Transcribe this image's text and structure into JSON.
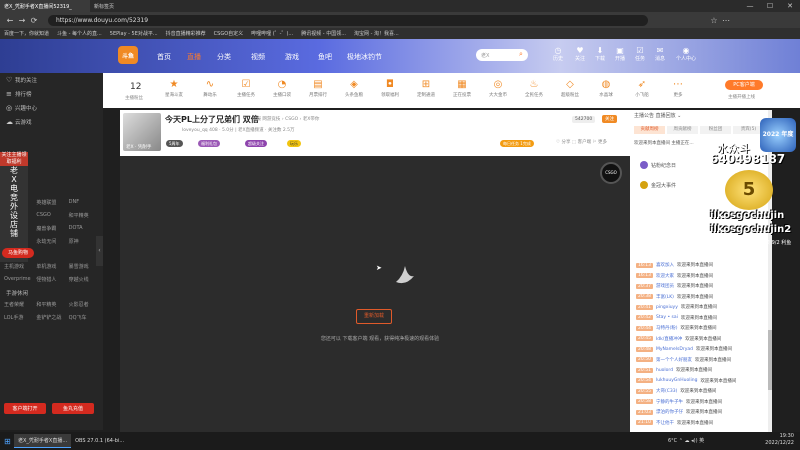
{
  "browser": {
    "tabs": [
      {
        "label": "老X_凭耐手者X直播间52319_"
      },
      {
        "label": "新标签页"
      }
    ],
    "url": "https://www.douyu.com/52319",
    "bookmarks": [
      "百度一下，你就知道",
      "斗鱼 - 每个人的直...",
      "5EPlay - 5E对战平...",
      "抖音直播精彩推荐",
      "CSGO自定义",
      "哔哩哔哩 (゜-゜)...",
      "腾讯视频 - 中国领...",
      "淘宝网 - 淘！我喜..."
    ]
  },
  "site": {
    "logo": "斗鱼",
    "nav": [
      {
        "label": "首页",
        "active": false
      },
      {
        "label": "直播",
        "active": true
      },
      {
        "label": "分类",
        "active": false
      },
      {
        "label": "视频",
        "active": false
      },
      {
        "label": "游戏",
        "active": false
      },
      {
        "label": "鱼吧",
        "active": false
      },
      {
        "label": "极地冰钓节",
        "active": false
      }
    ],
    "search_placeholder": "老X",
    "right_icons": [
      {
        "icon": "history-icon",
        "label": "历史"
      },
      {
        "icon": "follow-icon",
        "label": "关注"
      },
      {
        "icon": "download-icon",
        "label": "下载"
      },
      {
        "icon": "live-icon",
        "label": "开播"
      },
      {
        "icon": "task-icon",
        "label": "任务"
      },
      {
        "icon": "friend-icon",
        "label": "消息"
      },
      {
        "icon": "member-icon",
        "label": "个人中心"
      }
    ]
  },
  "sidebar": {
    "top_items": [
      {
        "label": "我的关注"
      },
      {
        "label": "排行榜"
      },
      {
        "label": "兴趣中心"
      },
      {
        "label": "云游戏"
      }
    ],
    "hot_games": [
      "热门游戏",
      "英雄联盟",
      "DNF",
      "绝地求生",
      "CSGO",
      "和平精英",
      "王者荣耀",
      "魔兽争霸",
      "DOTA",
      "APEX",
      "永劫无间",
      "原神"
    ],
    "section_single": "单机热游",
    "single_games": [
      "主机游戏",
      "单机游戏",
      "暴雪游戏",
      "Overprime",
      "怪物猎人",
      "穿越火线"
    ],
    "section_mobile": "手游休闲",
    "mobile_games": [
      "王者荣耀",
      "和平精英",
      "火影忍者",
      "LOL手游",
      "金铲铲之战",
      "QQ飞车"
    ],
    "btn_open_live": "客户端打开",
    "btn_recharge": "鱼丸充值"
  },
  "left_overlay": {
    "badge": "关注主播领取福利",
    "chars": [
      "老",
      "X",
      "电",
      "竞",
      "外",
      "设",
      "店",
      "铺"
    ],
    "button": "马鱼购物"
  },
  "gift_bar": {
    "count": "12",
    "count_label": "主播粉丝",
    "items": [
      "星海斗友",
      "舞动乐",
      "主播任务",
      "主播口袋",
      "月票排行",
      "头条鱼粮",
      "领取福利",
      "定制通道",
      "正在投票",
      "大大金币",
      "全民任务",
      "超级粉丝",
      "水晶球",
      "小飞船",
      "更多"
    ],
    "pc_button": "PC客户端",
    "pc_link": "主播开播上线"
  },
  "room": {
    "avatar_name": "老X · 凭耐手",
    "title": "今天PL上分了兄弟们 双倍",
    "meta": "举报  网游竞技 › CSGO › 老X带你",
    "streamer": "loveyou_qq  408  · 5.0分 | 老X直播频道  · 关注数 2.5万",
    "tags": [
      "5周年",
      "福利礼包",
      "超级关注",
      "玩乐"
    ],
    "task_tag": "每日任务 1完成",
    "right_actions": "♡ 分享   ⬚ 客户端   ⚐ 更多",
    "replay_button": "重新加载",
    "tip": "您还可以 下载客户端 观看，获得纯净极速的观看体验",
    "corner_logo": "CSGO"
  },
  "chat": {
    "tabs": "主播公告    直播回放 ⌄",
    "subtabs": [
      {
        "label": "贡献周榜",
        "active": true
      },
      {
        "label": "周贡献榜",
        "active": false
      },
      {
        "label": "粉丝团",
        "active": false
      },
      {
        "label": "贵宾(5)",
        "active": false
      }
    ],
    "notice": "欢迎来到本直播间  主播正在...",
    "ranks": [
      {
        "name": "钻粉纪念日"
      },
      {
        "name": "金冠大事件"
      }
    ],
    "messages": [
      {
        "time": "16:13",
        "name": "喜欢加入",
        "text": "欢迎来到本直播间"
      },
      {
        "time": "16:13",
        "name": "欢迎大家",
        "text": "欢迎来到本直播间"
      },
      {
        "time": "20:37",
        "name": "游戏团员",
        "text": "欢迎来到本直播间"
      },
      {
        "time": "20:38",
        "name": "丰富(LK)",
        "text": "欢迎来到本直播间"
      },
      {
        "time": "20:41",
        "name": "pingxiuyy",
        "text": "欢迎来到本直播间"
      },
      {
        "time": "20:42",
        "name": "Stay • sai",
        "text": "欢迎来到本直播间"
      },
      {
        "time": "20:44",
        "name": "马特丹(粉)",
        "text": "欢迎来到本直播间"
      },
      {
        "time": "20:45",
        "name": "Idk/直播冲冲",
        "text": "欢迎来到本直播间"
      },
      {
        "time": "20:48",
        "name": "MyNamelsDryad",
        "text": "欢迎来到本直播间"
      },
      {
        "time": "20:50",
        "name": "第一个个人好朋友",
        "text": "欢迎来到本直播间"
      },
      {
        "time": "20:51",
        "name": "huolord",
        "text": "欢迎来到本直播间"
      },
      {
        "time": "20:54",
        "name": "lukhuuyGnHuoling",
        "text": "欢迎来到本直播间"
      },
      {
        "time": "20:55",
        "name": "大哥(C33)",
        "text": "欢迎来到本直播间"
      },
      {
        "time": "20:58",
        "name": "宁静的牛子牛",
        "text": "欢迎来到本直播间"
      },
      {
        "time": "21:03",
        "name": "漂泊的你子仔",
        "text": "欢迎来到本直播间"
      },
      {
        "time": "21:10",
        "name": "不让他干",
        "text": "欢迎来到本直播间"
      }
    ]
  },
  "right_overlay": {
    "line1": "水众斗",
    "line2": "640498187",
    "gold": "5",
    "name1": "ilkosgochujin",
    "name2": "ilkosgochujin2",
    "small": "钟表 9/2 利鱼",
    "shield": "2022 年度"
  },
  "taskbar": {
    "apps": [
      {
        "label": "老X_凭耐手者X直播...",
        "active": true
      },
      {
        "label": "OBS 27.0.1 (64-bi...",
        "active": false
      }
    ],
    "tray": "6°C  ⌃  ☁  ◂))  英",
    "time": "19:30",
    "date": "2022/12/22"
  }
}
